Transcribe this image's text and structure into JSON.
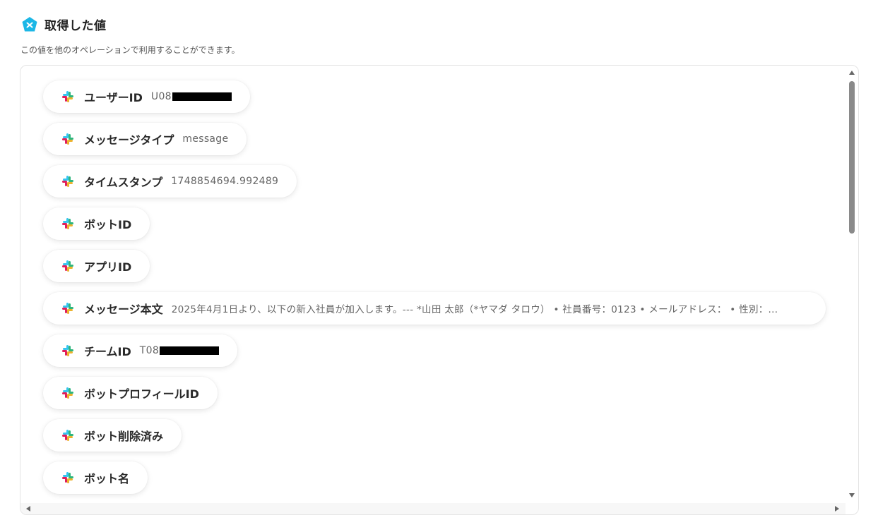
{
  "header": {
    "title": "取得した値",
    "subtitle": "この値を他のオペレーションで利用することができます。"
  },
  "items": [
    {
      "label": "ユーザーID",
      "value": "U08",
      "redacted": true
    },
    {
      "label": "メッセージタイプ",
      "value": "message",
      "redacted": false
    },
    {
      "label": "タイムスタンプ",
      "value": "1748854694.992489",
      "redacted": false
    },
    {
      "label": "ボットID",
      "value": "",
      "redacted": false
    },
    {
      "label": "アプリID",
      "value": "",
      "redacted": false
    },
    {
      "label": "メッセージ本文",
      "value": "2025年4月1日より、以下の新入社員が加入します。--- *山田 太郎（*ヤマダ タロウ） • 社員番号：0123 • メールアドレス： • 性別：...",
      "redacted": false
    },
    {
      "label": "チームID",
      "value": "T08",
      "redacted": true
    },
    {
      "label": "ボットプロフィールID",
      "value": "",
      "redacted": false
    },
    {
      "label": "ボット削除済み",
      "value": "",
      "redacted": false
    },
    {
      "label": "ボット名",
      "value": "",
      "redacted": false
    }
  ],
  "icons": {
    "header": "yoom-logo-icon",
    "item": "slack-icon"
  },
  "colors": {
    "logo": "#1cb7e6",
    "slack_blue": "#36c5f0",
    "slack_green": "#2eb67d",
    "slack_yellow": "#ecb22e",
    "slack_red": "#e01e5a"
  }
}
